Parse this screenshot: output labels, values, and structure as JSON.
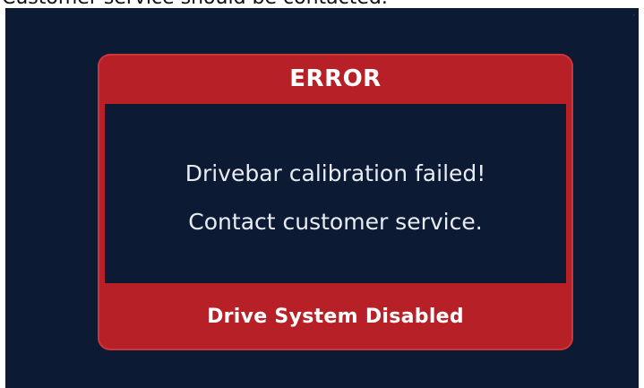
{
  "caption": "Customer service should be contacted.",
  "dialog": {
    "title": "ERROR",
    "message_line_1": "Drivebar calibration failed!",
    "message_line_2": "Contact customer service.",
    "footer": "Drive System Disabled"
  },
  "colors": {
    "screen_background": "#0d1a33",
    "dialog_red": "#b72027",
    "text_white": "#ffffff"
  }
}
